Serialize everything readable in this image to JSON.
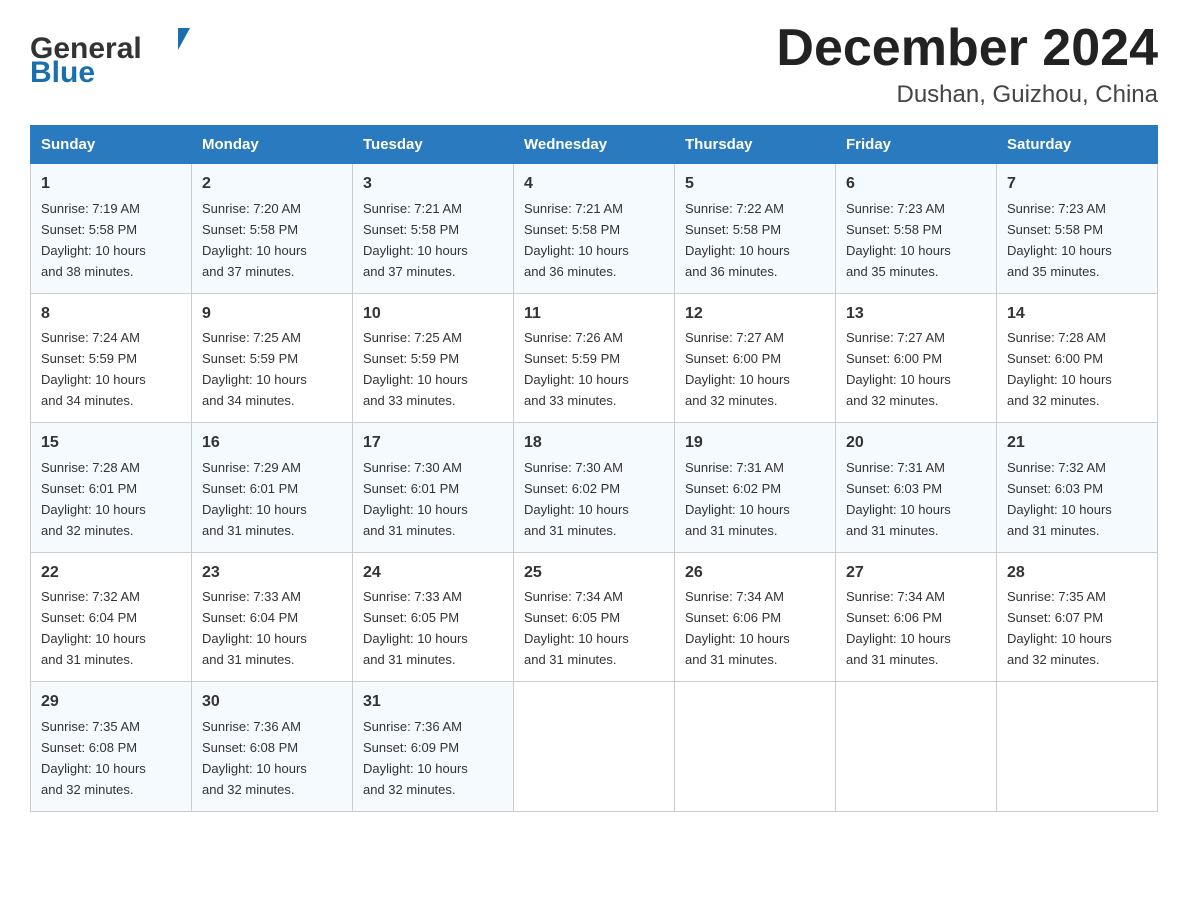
{
  "logo": {
    "general": "General",
    "blue": "Blue",
    "triangle_color": "#1a6faf"
  },
  "header": {
    "month": "December 2024",
    "location": "Dushan, Guizhou, China"
  },
  "days_of_week": [
    "Sunday",
    "Monday",
    "Tuesday",
    "Wednesday",
    "Thursday",
    "Friday",
    "Saturday"
  ],
  "weeks": [
    [
      {
        "day": "1",
        "sunrise": "7:19 AM",
        "sunset": "5:58 PM",
        "daylight": "10 hours and 38 minutes."
      },
      {
        "day": "2",
        "sunrise": "7:20 AM",
        "sunset": "5:58 PM",
        "daylight": "10 hours and 37 minutes."
      },
      {
        "day": "3",
        "sunrise": "7:21 AM",
        "sunset": "5:58 PM",
        "daylight": "10 hours and 37 minutes."
      },
      {
        "day": "4",
        "sunrise": "7:21 AM",
        "sunset": "5:58 PM",
        "daylight": "10 hours and 36 minutes."
      },
      {
        "day": "5",
        "sunrise": "7:22 AM",
        "sunset": "5:58 PM",
        "daylight": "10 hours and 36 minutes."
      },
      {
        "day": "6",
        "sunrise": "7:23 AM",
        "sunset": "5:58 PM",
        "daylight": "10 hours and 35 minutes."
      },
      {
        "day": "7",
        "sunrise": "7:23 AM",
        "sunset": "5:58 PM",
        "daylight": "10 hours and 35 minutes."
      }
    ],
    [
      {
        "day": "8",
        "sunrise": "7:24 AM",
        "sunset": "5:59 PM",
        "daylight": "10 hours and 34 minutes."
      },
      {
        "day": "9",
        "sunrise": "7:25 AM",
        "sunset": "5:59 PM",
        "daylight": "10 hours and 34 minutes."
      },
      {
        "day": "10",
        "sunrise": "7:25 AM",
        "sunset": "5:59 PM",
        "daylight": "10 hours and 33 minutes."
      },
      {
        "day": "11",
        "sunrise": "7:26 AM",
        "sunset": "5:59 PM",
        "daylight": "10 hours and 33 minutes."
      },
      {
        "day": "12",
        "sunrise": "7:27 AM",
        "sunset": "6:00 PM",
        "daylight": "10 hours and 32 minutes."
      },
      {
        "day": "13",
        "sunrise": "7:27 AM",
        "sunset": "6:00 PM",
        "daylight": "10 hours and 32 minutes."
      },
      {
        "day": "14",
        "sunrise": "7:28 AM",
        "sunset": "6:00 PM",
        "daylight": "10 hours and 32 minutes."
      }
    ],
    [
      {
        "day": "15",
        "sunrise": "7:28 AM",
        "sunset": "6:01 PM",
        "daylight": "10 hours and 32 minutes."
      },
      {
        "day": "16",
        "sunrise": "7:29 AM",
        "sunset": "6:01 PM",
        "daylight": "10 hours and 31 minutes."
      },
      {
        "day": "17",
        "sunrise": "7:30 AM",
        "sunset": "6:01 PM",
        "daylight": "10 hours and 31 minutes."
      },
      {
        "day": "18",
        "sunrise": "7:30 AM",
        "sunset": "6:02 PM",
        "daylight": "10 hours and 31 minutes."
      },
      {
        "day": "19",
        "sunrise": "7:31 AM",
        "sunset": "6:02 PM",
        "daylight": "10 hours and 31 minutes."
      },
      {
        "day": "20",
        "sunrise": "7:31 AM",
        "sunset": "6:03 PM",
        "daylight": "10 hours and 31 minutes."
      },
      {
        "day": "21",
        "sunrise": "7:32 AM",
        "sunset": "6:03 PM",
        "daylight": "10 hours and 31 minutes."
      }
    ],
    [
      {
        "day": "22",
        "sunrise": "7:32 AM",
        "sunset": "6:04 PM",
        "daylight": "10 hours and 31 minutes."
      },
      {
        "day": "23",
        "sunrise": "7:33 AM",
        "sunset": "6:04 PM",
        "daylight": "10 hours and 31 minutes."
      },
      {
        "day": "24",
        "sunrise": "7:33 AM",
        "sunset": "6:05 PM",
        "daylight": "10 hours and 31 minutes."
      },
      {
        "day": "25",
        "sunrise": "7:34 AM",
        "sunset": "6:05 PM",
        "daylight": "10 hours and 31 minutes."
      },
      {
        "day": "26",
        "sunrise": "7:34 AM",
        "sunset": "6:06 PM",
        "daylight": "10 hours and 31 minutes."
      },
      {
        "day": "27",
        "sunrise": "7:34 AM",
        "sunset": "6:06 PM",
        "daylight": "10 hours and 31 minutes."
      },
      {
        "day": "28",
        "sunrise": "7:35 AM",
        "sunset": "6:07 PM",
        "daylight": "10 hours and 32 minutes."
      }
    ],
    [
      {
        "day": "29",
        "sunrise": "7:35 AM",
        "sunset": "6:08 PM",
        "daylight": "10 hours and 32 minutes."
      },
      {
        "day": "30",
        "sunrise": "7:36 AM",
        "sunset": "6:08 PM",
        "daylight": "10 hours and 32 minutes."
      },
      {
        "day": "31",
        "sunrise": "7:36 AM",
        "sunset": "6:09 PM",
        "daylight": "10 hours and 32 minutes."
      },
      null,
      null,
      null,
      null
    ]
  ],
  "labels": {
    "sunrise": "Sunrise:",
    "sunset": "Sunset:",
    "daylight": "Daylight:"
  }
}
